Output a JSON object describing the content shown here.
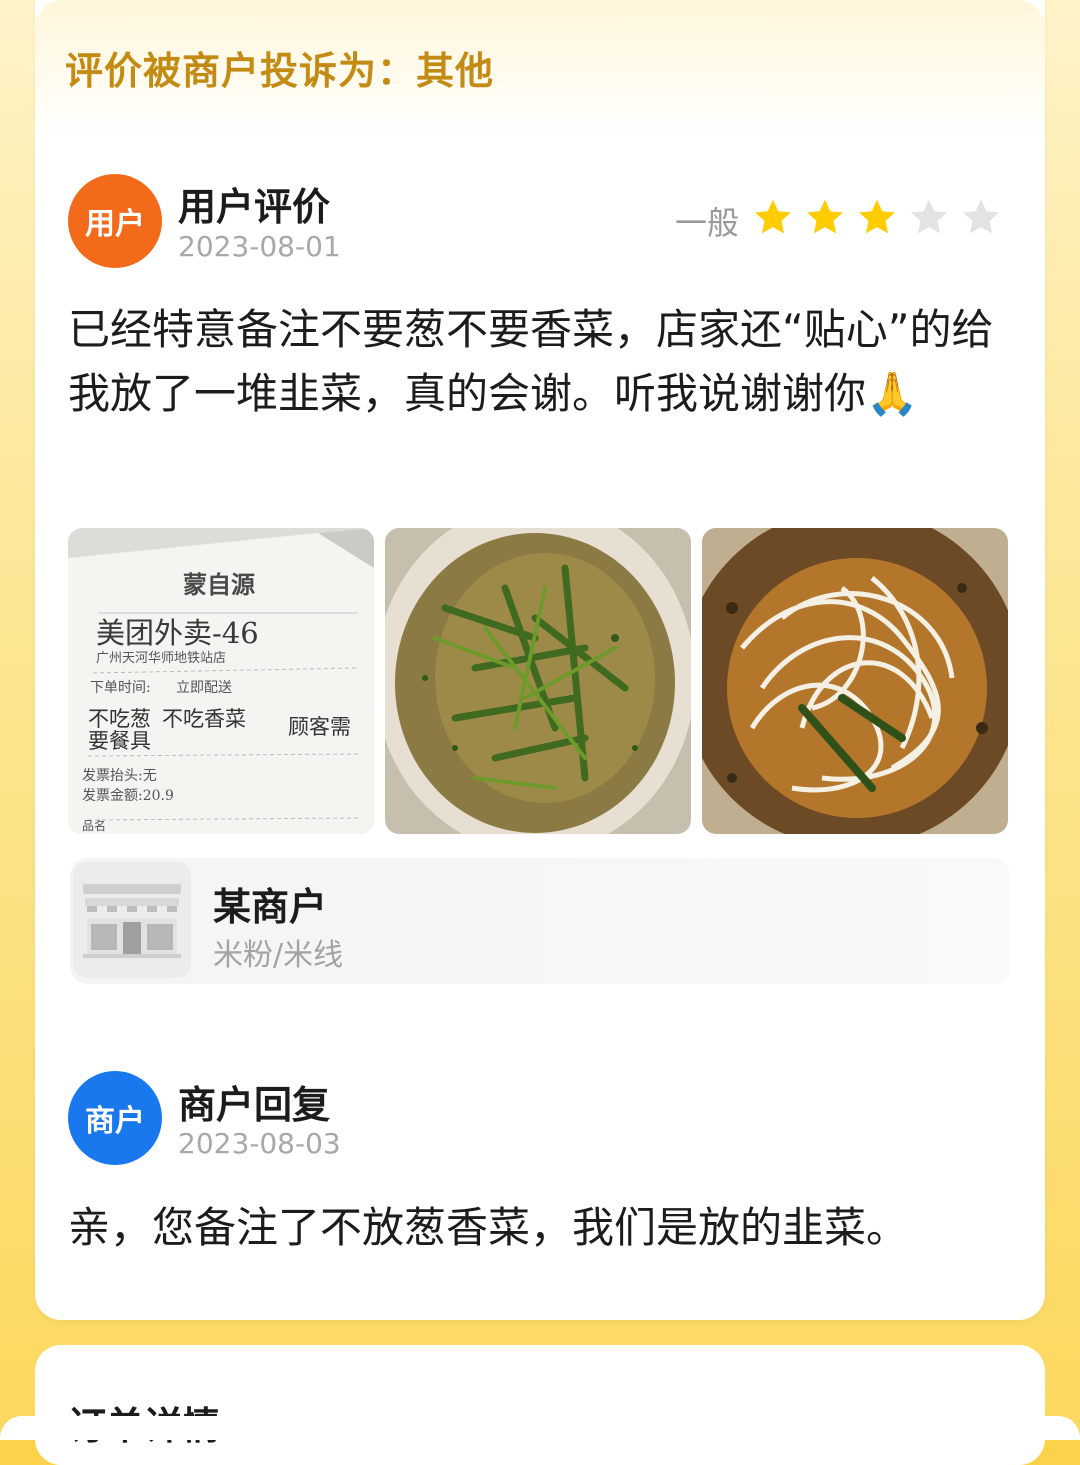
{
  "complaint": {
    "title": "评价被商户投诉为：其他"
  },
  "review": {
    "avatar_label": "用户",
    "name": "用户评价",
    "date": "2023-08-01",
    "rating_label": "一般",
    "rating_stars": 3,
    "rating_max": 5,
    "text": "已经特意备注不要葱不要香菜，店家还“贴心”的给我放了一堆韭菜，真的会谢。听我说谢谢你🙏",
    "photos": [
      {
        "name": "receipt-photo",
        "lines": [
          "蒙自源",
          "美团外卖-46",
          "广州天河华师地铁站店",
          "下单时间:",
          "立即配送",
          "不吃葱",
          "不吃香菜",
          "顾客需",
          "要餐具",
          "发票抬头:无",
          "发票金额:20.9",
          "品名"
        ]
      },
      {
        "name": "chive-bowl-photo"
      },
      {
        "name": "noodle-bowl-photo"
      }
    ]
  },
  "merchant_card": {
    "icon": "storefront-icon",
    "name": "某商户",
    "category": "米粉/米线"
  },
  "reply": {
    "avatar_label": "商户",
    "name": "商户回复",
    "date": "2023-08-03",
    "text": "亲，您备注了不放葱香菜，我们是放的韭菜。"
  },
  "order": {
    "title": "订单详情"
  },
  "colors": {
    "accent_gold": "#c38b14",
    "star_yellow": "#ffcc00",
    "user_avatar": "#f26a1a",
    "merchant_avatar": "#1a78ee",
    "background_yellow": "#fbd24a"
  }
}
